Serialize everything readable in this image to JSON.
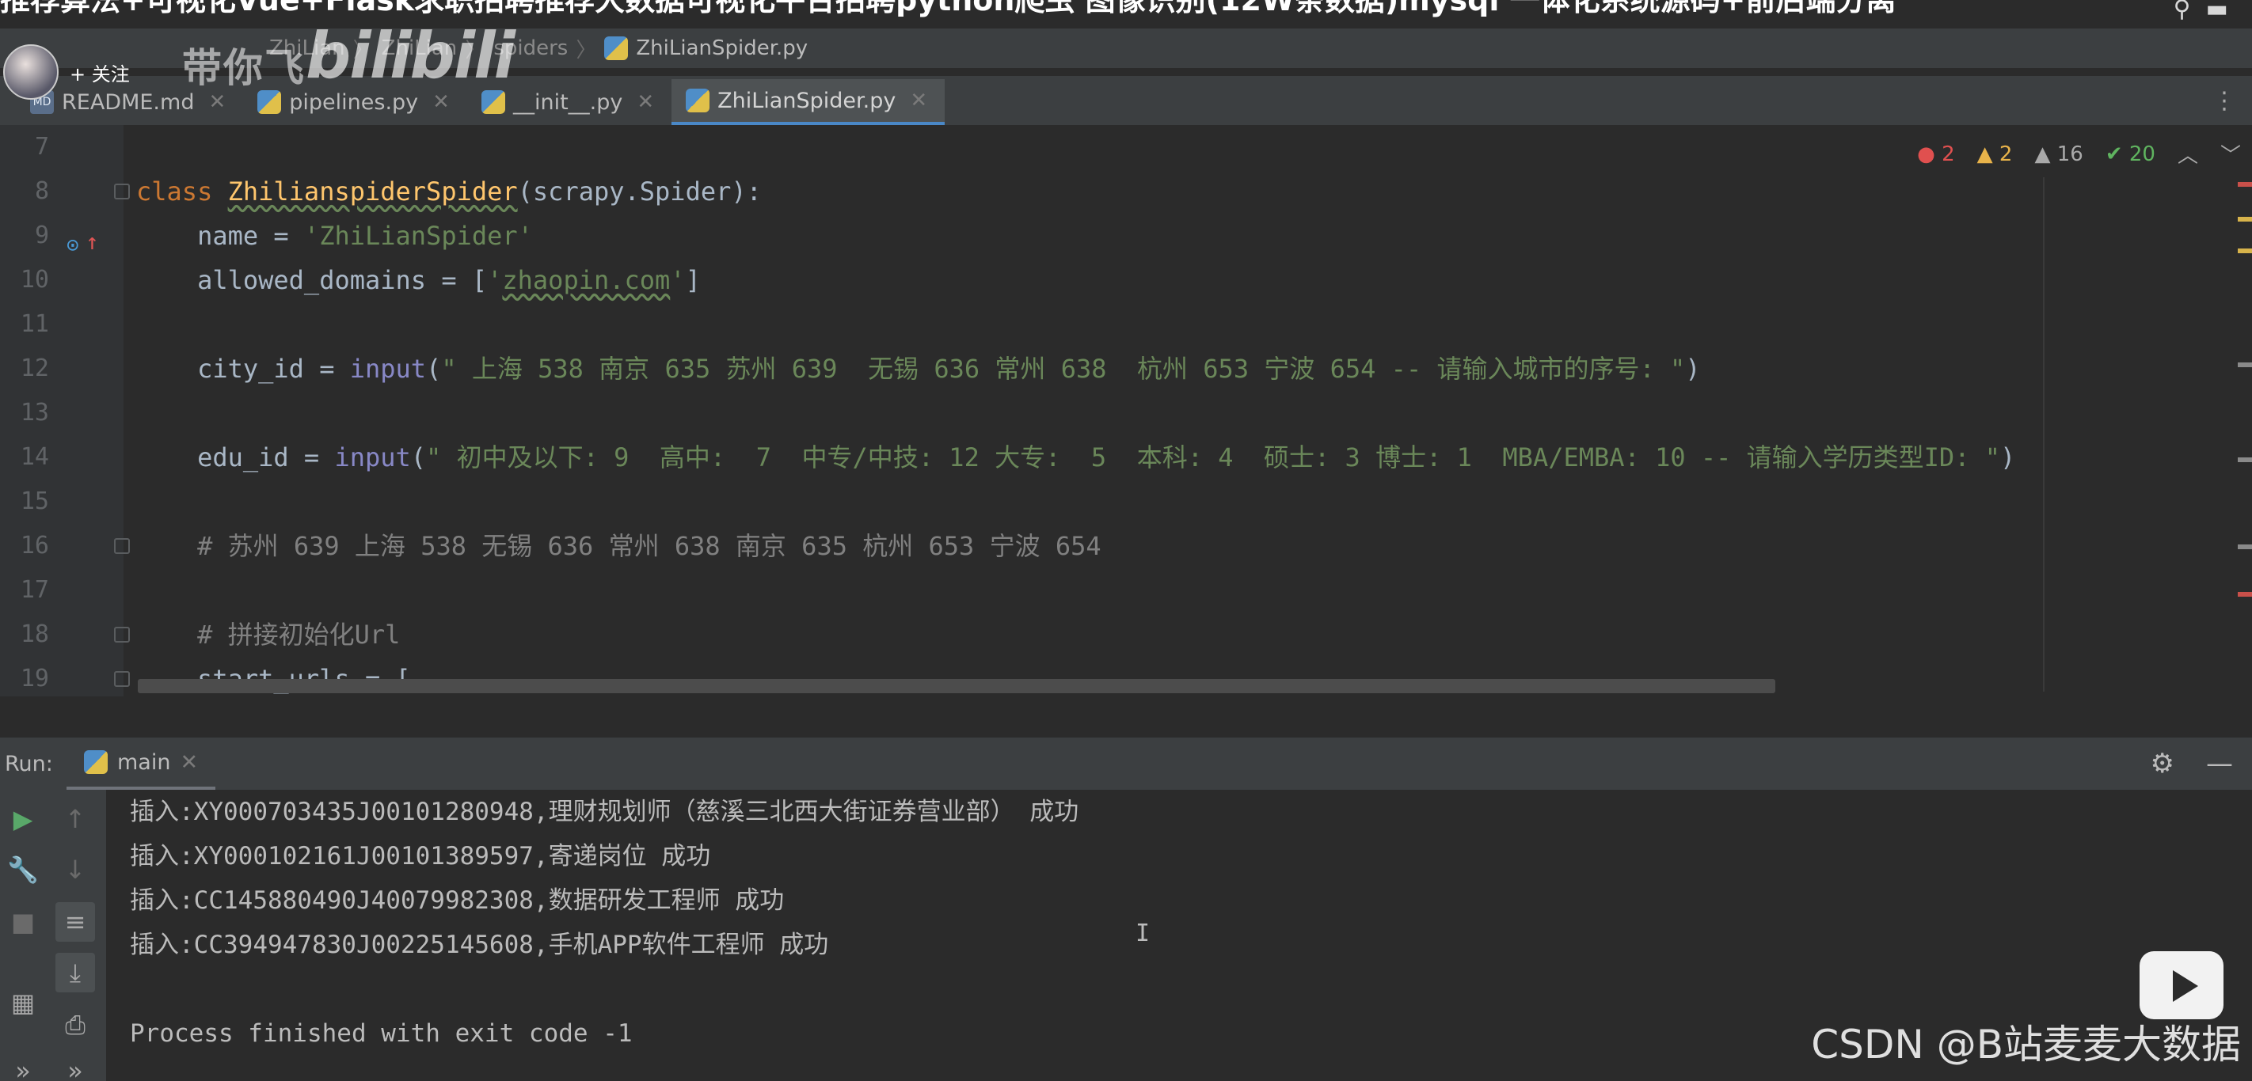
{
  "overlay": {
    "video_title": "推荐算法+可视化Vue+Flask求职招聘推荐大数据可视化平台招聘python爬虫 图像识别(12W条数据)mysql 一体化系统源码+前后端分离",
    "follow_label": "+ 关注",
    "uploader_name": "带你飞",
    "platform_logo": "bilibili",
    "watermark": "CSDN @B站麦麦大数据"
  },
  "breadcrumb": {
    "items": [
      "ZhiLian",
      "ZhiLian",
      "spiders"
    ],
    "file": "ZhiLianSpider.py"
  },
  "tabs": [
    {
      "label": "README.md",
      "icon": "markdown-file-icon",
      "active": false
    },
    {
      "label": "pipelines.py",
      "icon": "python-file-icon",
      "active": false
    },
    {
      "label": "__init__.py",
      "icon": "python-file-icon",
      "active": false
    },
    {
      "label": "ZhiLianSpider.py",
      "icon": "python-file-icon",
      "active": true
    }
  ],
  "inspections": {
    "errors": "2",
    "warnings": "2",
    "weak_warnings": "16",
    "ok": "20"
  },
  "editor": {
    "lines": [
      {
        "num": "7"
      },
      {
        "num": "8",
        "class_kw": "class",
        "class_name": "ZhilianspiderSpider",
        "class_rest": "(scrapy.Spider):"
      },
      {
        "num": "9",
        "name_pre": "    name = ",
        "name_val": "'ZhiLianSpider'"
      },
      {
        "num": "10",
        "dom_pre": "    allowed_domains = [",
        "dom_q1": "'",
        "dom_val": "zhaopin.com",
        "dom_q2": "'",
        "dom_post": "]"
      },
      {
        "num": "11"
      },
      {
        "num": "12",
        "city_pre": "    city_id = ",
        "city_fn": "input",
        "city_open": "(",
        "city_str": "\" 上海 538 南京 635 苏州 639  无锡 636 常州 638  杭州 653 宁波 654 -- 请输入城市的序号: \"",
        "city_close": ")"
      },
      {
        "num": "13"
      },
      {
        "num": "14",
        "edu_pre": "    edu_id = ",
        "edu_fn": "input",
        "edu_open": "(",
        "edu_str": "\" 初中及以下: 9  高中:  7  中专/中技: 12 大专:  5  本科: 4  硕士: 3 博士: 1  MBA/EMBA: 10 -- 请输入学历类型ID: \"",
        "edu_close": ")"
      },
      {
        "num": "15"
      },
      {
        "num": "16",
        "comment": "    # 苏州 639 上海 538 无锡 636 常州 638 南京 635 杭州 653 宁波 654"
      },
      {
        "num": "17"
      },
      {
        "num": "18",
        "comment": "    # 拼接初始化Url"
      },
      {
        "num": "19",
        "code": "    start_urls = ["
      }
    ]
  },
  "run": {
    "label": "Run:",
    "tab_label": "main",
    "console": [
      "插入:XY000703435J00101280948,理财规划师（慈溪三北西大街证券营业部） 成功",
      "插入:XY000102161J00101389597,寄递岗位 成功",
      "插入:CC145880490J40079982308,数据研发工程师 成功",
      "插入:CC394947830J00225145608,手机APP软件工程师 成功",
      "",
      "Process finished with exit code -1"
    ],
    "caret_glyph": "I"
  },
  "colors": {
    "editor_bg": "#2b2b2b",
    "keyword": "#cc7832",
    "string": "#6a8759",
    "class_name": "#ffc66d",
    "comment": "#808080",
    "builtin": "#8888c6",
    "active_tab_underline": "#4a88c7"
  }
}
